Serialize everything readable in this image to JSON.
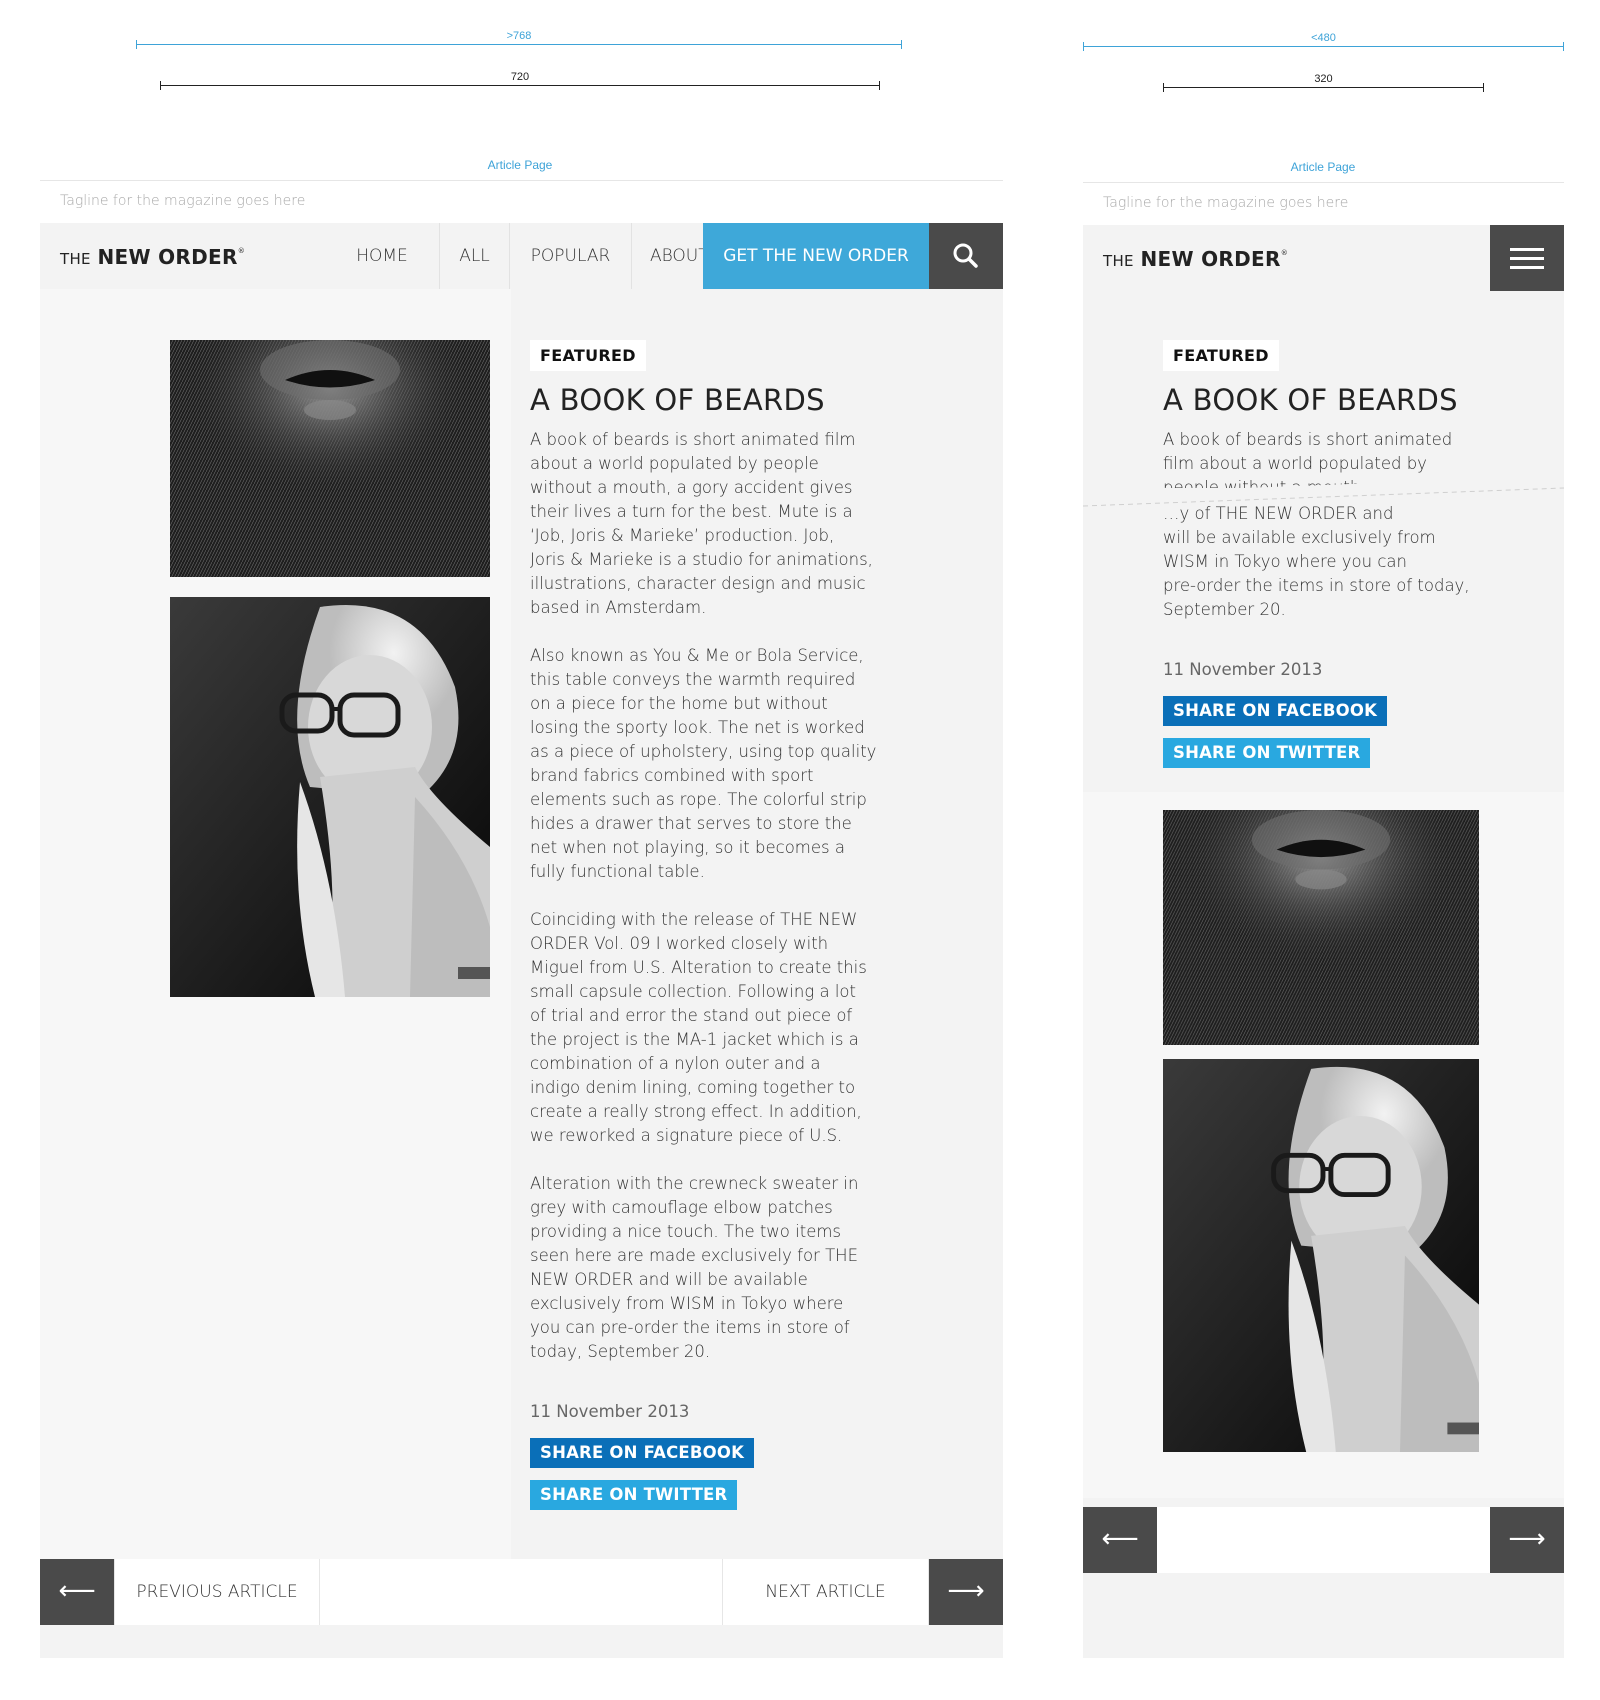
{
  "annotations": {
    "desktop_breakpoint": ">768",
    "desktop_width": "720",
    "mobile_breakpoint": "<480",
    "mobile_width": "320",
    "page_label": "Article Page"
  },
  "header": {
    "tagline": "Tagline for the magazine goes here",
    "logo_prefix": "THE",
    "logo_main": "NEW ORDER",
    "logo_mark": "®"
  },
  "nav": {
    "items": [
      "HOME",
      "ALL",
      "POPULAR",
      "ABOUT"
    ],
    "cta": "GET THE NEW ORDER",
    "icons": {
      "search": "search-icon",
      "menu": "hamburger-menu-icon",
      "dropdown": "chevron-down-icon"
    }
  },
  "article": {
    "tag": "FEATURED",
    "title": "A BOOK OF BEARDS",
    "paragraphs": [
      "A book of beards is short animated film\nabout a world populated by people\nwithout a mouth, a gory accident gives\ntheir lives a turn for the best. Mute is a\n‘Job, Joris & Marieke’ production. Job,\nJoris & Marieke is a studio for animations,\nillustrations, character design and music\nbased in Amsterdam.",
      "Also known as You & Me or Bola Service,\nthis table conveys the warmth required\non a piece for the home but without\nlosing the sporty look. The net is worked\nas a piece of upholstery, using top quality\nbrand fabrics combined with sport\nelements such as rope. The colorful strip\nhides a drawer that serves to store the\nnet when not playing, so it becomes a\nfully functional table.",
      "Coinciding with the release of THE NEW\nORDER Vol. 09 I worked closely with\nMiguel from U.S. Alteration to create this\nsmall capsule collection. Following a lot\nof trial and error the stand out piece of\nthe project is the MA-1 jacket which is a\ncombination of a nylon outer and a\nindigo denim lining, coming together to\ncreate a really strong effect. In addition,\nwe reworked a signature piece of U.S.",
      "Alteration with the crewneck sweater in\ngrey with camouflage elbow patches\nproviding a nice touch. The two items\nseen here are made exclusively for THE\nNEW ORDER and will be available\nexclusively from WISM in Tokyo where\nyou can pre-order the items in store of\ntoday, September 20."
    ],
    "mobile_intro": "A book of beards is short animated\nfilm about a world populated by\npeople without a mouth, a gory",
    "mobile_outro_cut": "…y of THE NEW ORDER and",
    "mobile_outro": "will be available exclusively from\nWISM in Tokyo where you can\npre-order the items in store of today,\nSeptember 20.",
    "date": "11 November 2013",
    "share_facebook": "SHARE ON FACEBOOK",
    "share_twitter": "SHARE ON TWITTER"
  },
  "article_nav": {
    "previous": "PREVIOUS ARTICLE",
    "next": "NEXT ARTICLE",
    "prev_icon": "arrow-left-icon",
    "next_icon": "arrow-right-icon"
  },
  "colors": {
    "accent": "#3ea8d9",
    "facebook": "#0a6fb8",
    "twitter": "#29a8e0",
    "dark": "#4a4a4a",
    "guide": "#3ea3d8"
  }
}
